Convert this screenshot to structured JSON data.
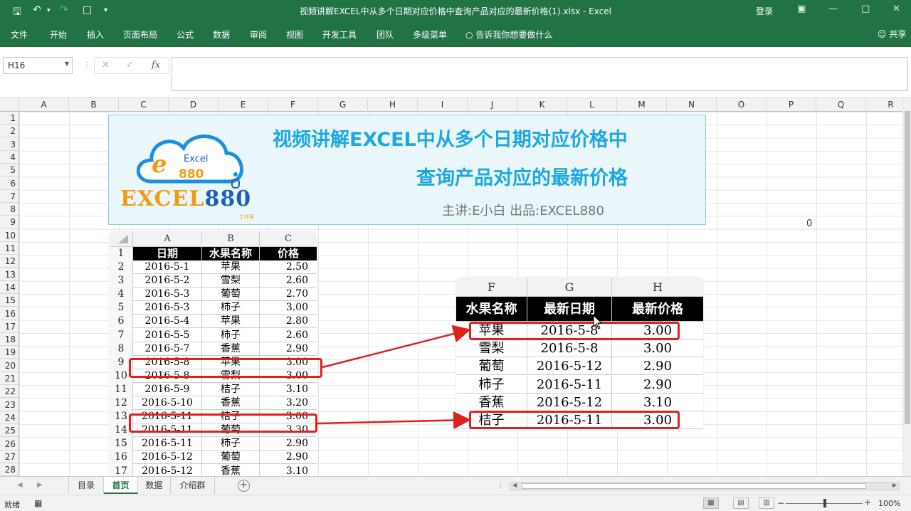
{
  "window": {
    "title": "视频讲解EXCEL中从多个日期对应价格中查询产品对应的最新价格(1).xlsx  -  Excel",
    "login": "登录"
  },
  "ribbon": {
    "tabs": [
      "文件",
      "开始",
      "插入",
      "页面布局",
      "公式",
      "数据",
      "审阅",
      "视图",
      "开发工具",
      "团队",
      "多级菜单"
    ],
    "tell_me": "告诉我你想要做什么",
    "share": "共享"
  },
  "formula_bar": {
    "name_box": "H16",
    "formula": ""
  },
  "columns": [
    "A",
    "B",
    "C",
    "D",
    "E",
    "F",
    "G",
    "H",
    "I",
    "J",
    "K",
    "L",
    "M",
    "N",
    "O",
    "P",
    "Q",
    "R"
  ],
  "rows": [
    "1",
    "2",
    "3",
    "4",
    "5",
    "6",
    "7",
    "8",
    "9",
    "10",
    "11",
    "12",
    "13",
    "14",
    "15",
    "16",
    "17",
    "18",
    "19",
    "20",
    "21",
    "22",
    "23",
    "24",
    "25",
    "26",
    "27",
    "28"
  ],
  "cell_p9": "0",
  "banner": {
    "title_line1": "视频讲解EXCEL中从多个日期对应价格中",
    "title_line2": "查询产品对应的最新价格",
    "credit": "主讲:E小白   出品:EXCEL880",
    "logo_cloud_text": "Excel",
    "logo_cloud_num": "880",
    "logo_word_a": "EXCEL",
    "logo_word_b": "880",
    "logo_sub": "工作室"
  },
  "source_table": {
    "col_headers": [
      "A",
      "B",
      "C"
    ],
    "headers": [
      "日期",
      "水果名称",
      "价格"
    ],
    "rows": [
      {
        "n": "2",
        "date": "2016-5-1",
        "fruit": "苹果",
        "price": "2.50"
      },
      {
        "n": "3",
        "date": "2016-5-2",
        "fruit": "雪梨",
        "price": "2.60"
      },
      {
        "n": "4",
        "date": "2016-5-3",
        "fruit": "葡萄",
        "price": "2.70"
      },
      {
        "n": "5",
        "date": "2016-5-3",
        "fruit": "柿子",
        "price": "3.00"
      },
      {
        "n": "6",
        "date": "2016-5-4",
        "fruit": "苹果",
        "price": "2.80"
      },
      {
        "n": "7",
        "date": "2016-5-5",
        "fruit": "柿子",
        "price": "2.60"
      },
      {
        "n": "8",
        "date": "2016-5-7",
        "fruit": "香蕉",
        "price": "2.90"
      },
      {
        "n": "9",
        "date": "2016-5-8",
        "fruit": "苹果",
        "price": "3.00"
      },
      {
        "n": "10",
        "date": "2016-5-8",
        "fruit": "雪梨",
        "price": "3.00"
      },
      {
        "n": "11",
        "date": "2016-5-9",
        "fruit": "桔子",
        "price": "3.10"
      },
      {
        "n": "12",
        "date": "2016-5-10",
        "fruit": "香蕉",
        "price": "3.20"
      },
      {
        "n": "13",
        "date": "2016-5-11",
        "fruit": "桔子",
        "price": "3.00"
      },
      {
        "n": "14",
        "date": "2016-5-11",
        "fruit": "葡萄",
        "price": "3.30"
      },
      {
        "n": "15",
        "date": "2016-5-11",
        "fruit": "柿子",
        "price": "2.90"
      },
      {
        "n": "16",
        "date": "2016-5-12",
        "fruit": "葡萄",
        "price": "2.90"
      },
      {
        "n": "17",
        "date": "2016-5-12",
        "fruit": "香蕉",
        "price": "3.10"
      }
    ]
  },
  "result_table": {
    "col_headers": [
      "F",
      "G",
      "H"
    ],
    "headers": [
      "水果名称",
      "最新日期",
      "最新价格"
    ],
    "rows": [
      {
        "fruit": "苹果",
        "date": "2016-5-8",
        "price": "3.00"
      },
      {
        "fruit": "雪梨",
        "date": "2016-5-8",
        "price": "3.00"
      },
      {
        "fruit": "葡萄",
        "date": "2016-5-12",
        "price": "2.90"
      },
      {
        "fruit": "柿子",
        "date": "2016-5-11",
        "price": "2.90"
      },
      {
        "fruit": "香蕉",
        "date": "2016-5-12",
        "price": "3.10"
      },
      {
        "fruit": "桔子",
        "date": "2016-5-11",
        "price": "3.00"
      }
    ]
  },
  "sheet_tabs": [
    "目录",
    "首页",
    "数据",
    "介绍群"
  ],
  "active_sheet": "首页",
  "status": {
    "ready": "就绪",
    "zoom": "100%"
  },
  "colors": {
    "excel_green": "#217346",
    "highlight_red": "#e0201b",
    "title_blue": "#1ea7e1"
  }
}
